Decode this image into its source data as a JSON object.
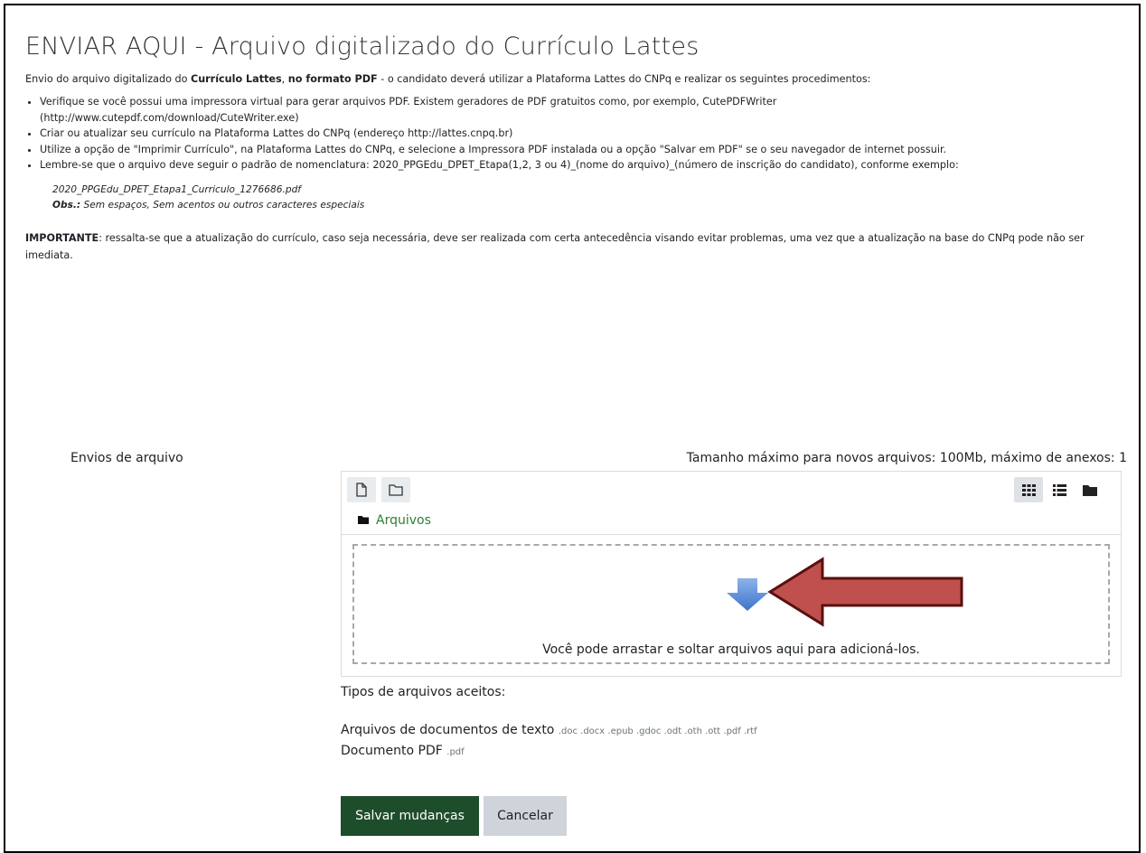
{
  "heading": {
    "title": "ENVIAR AQUI - Arquivo digitalizado do Currículo Lattes"
  },
  "intro": {
    "prefix": "Envio do arquivo digitalizado do ",
    "bold1": "Currículo Lattes",
    "sep": ", ",
    "bold2": "no formato PDF",
    "suffix": " - o candidato deverá utilizar a Plataforma Lattes do CNPq e realizar os seguintes procedimentos:"
  },
  "steps": {
    "item0": "Verifique se você possui uma impressora virtual para gerar arquivos PDF. Existem geradores de PDF gratuitos como, por exemplo, CutePDFWriter",
    "item0_link": "(http://www.cutepdf.com/download/CuteWriter.exe)",
    "item1_prefix": "Criar ou atualizar seu currículo na Plataforma Lattes do CNPq (endereço ",
    "item1_link": "http://lattes.cnpq.br",
    "item1_suffix": ")",
    "item2": "Utilize a opção de \"Imprimir Currículo\", na Plataforma Lattes do CNPq, e selecione a Impressora PDF instalada ou a opção \"Salvar em PDF\" se o seu navegador de internet possuir.",
    "item3": "Lembre-se que o arquivo deve seguir o padrão de nomenclatura: 2020_PPGEdu_DPET_Etapa(1,2, 3 ou 4)_(nome do arquivo)_(número de inscrição do candidato), conforme exemplo:"
  },
  "example": {
    "filename": "2020_PPGEdu_DPET_Etapa1_Curriculo_1276686.pdf",
    "obs_label": "Obs.:",
    "obs_text": " Sem espaços, Sem acentos ou outros caracteres especiais"
  },
  "important": {
    "label": "IMPORTANTE",
    "text": ": ressalta-se que a atualização do currículo, caso seja necessária, deve ser realizada com certa antecedência visando evitar problemas, uma vez que a atualização na base do CNPq pode não ser imediata."
  },
  "upload": {
    "label": "Envios de arquivo",
    "max_info": "Tamanho máximo para novos arquivos: 100Mb, máximo de anexos: 1",
    "breadcrumb": "Arquivos",
    "drop_text": "Você pode arrastar e soltar arquivos aqui para adicioná-los.",
    "icons": [
      "new-file-icon",
      "new-folder-icon",
      "grid-view-icon",
      "list-view-icon",
      "tree-view-icon",
      "folder-icon",
      "down-arrow-icon"
    ]
  },
  "accepted": {
    "label": "Tipos de arquivos aceitos:",
    "types": [
      {
        "name": "Arquivos de documentos de texto",
        "exts": ".doc .docx .epub .gdoc .odt .oth .ott .pdf .rtf"
      },
      {
        "name": "Documento PDF",
        "exts": ".pdf"
      }
    ]
  },
  "buttons": {
    "save": "Salvar mudanças",
    "cancel": "Cancelar"
  },
  "colors": {
    "save_bg": "#1e4d2b",
    "link": "#2e7d32",
    "annotation_arrow": "#c0504d",
    "drop_arrow": "#5b8fd8"
  }
}
